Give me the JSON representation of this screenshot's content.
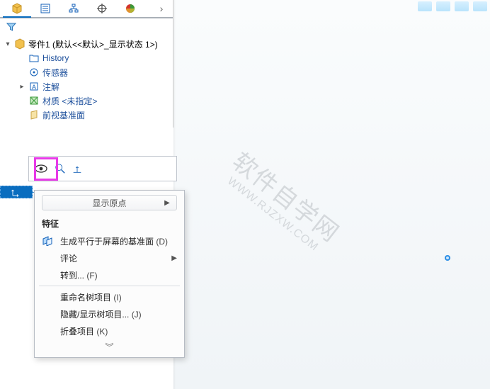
{
  "sidebar": {
    "rootLabel": "零件1 (默认<<默认>_显示状态 1>)",
    "items": [
      {
        "label": "History"
      },
      {
        "label": "传感器"
      },
      {
        "label": "注解"
      },
      {
        "label": "材质 <未指定>"
      },
      {
        "label": "前视基准面"
      }
    ]
  },
  "contextMenu": {
    "headerLabel": "显示原点",
    "sectionLabel": "特征",
    "items": [
      {
        "label": "生成平行于屏幕的基准面",
        "accel": "(D)"
      },
      {
        "label": "评论",
        "hasSub": true
      },
      {
        "label": "转到...",
        "accel": "(F)"
      },
      {
        "sep": true
      },
      {
        "label": "重命名树项目",
        "accel": "(I)"
      },
      {
        "label": "隐藏/显示树项目...",
        "accel": "(J)"
      },
      {
        "label": "折叠项目",
        "accel": "(K)"
      }
    ],
    "chevrons": "︾"
  },
  "watermark": {
    "line1": "软件自学网",
    "line2": "WWW.RJZXW.COM"
  }
}
